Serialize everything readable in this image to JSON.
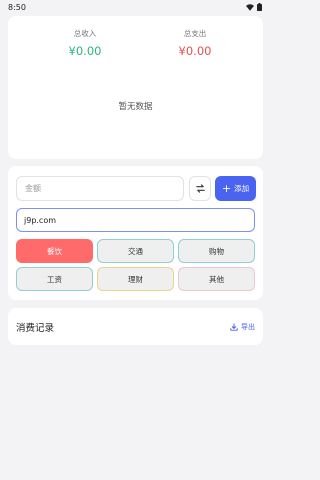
{
  "status": {
    "time": "8:50"
  },
  "summary": {
    "income_label": "总收入",
    "income_value": "¥0.00",
    "expense_label": "总支出",
    "expense_value": "¥0.00",
    "empty_text": "暂无数据"
  },
  "form": {
    "amount_placeholder": "金额",
    "add_label": "添加",
    "note_value": "j9p.com",
    "categories": [
      {
        "label": "餐饮",
        "selected": true
      },
      {
        "label": "交通",
        "selected": false
      },
      {
        "label": "购物",
        "selected": false
      },
      {
        "label": "工资",
        "selected": false
      },
      {
        "label": "理财",
        "selected": false
      },
      {
        "label": "其他",
        "selected": false
      }
    ]
  },
  "records": {
    "title": "消费记录",
    "export_label": "导出"
  },
  "colors": {
    "accent": "#4a63f0",
    "income": "#2bb37d",
    "expense": "#e45050",
    "selected_category": "#ff6b6b"
  },
  "icons": [
    "wifi-icon",
    "battery-icon",
    "swap-icon",
    "plus-icon",
    "download-icon"
  ]
}
